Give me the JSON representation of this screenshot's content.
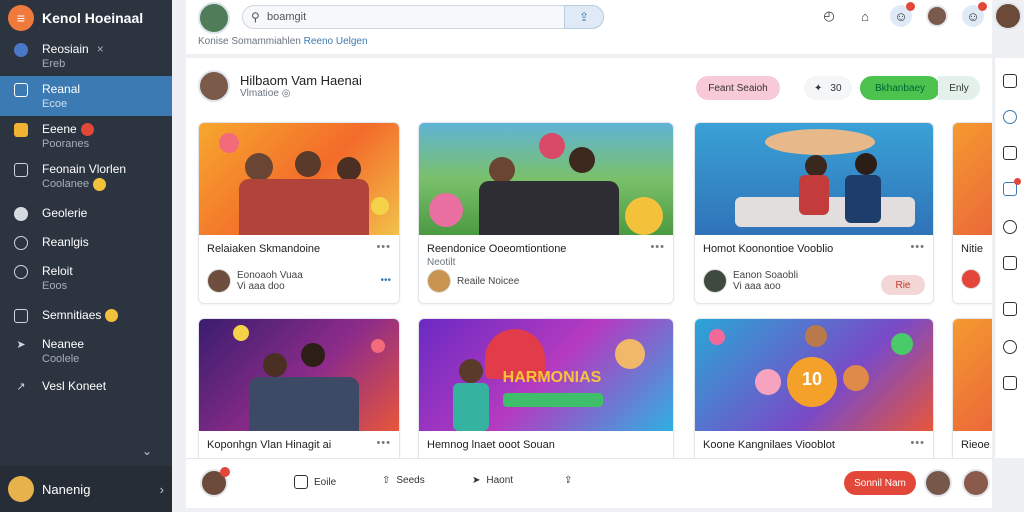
{
  "brand": {
    "name": "Kenol Hoeinaal"
  },
  "sidebar": {
    "items": [
      {
        "label": "Reosiain",
        "sub": "Ereb",
        "extra": "×",
        "active": false,
        "icon": "globe-icon"
      },
      {
        "label": "Reanal",
        "sub": "Ecoe",
        "extra": "",
        "active": true,
        "icon": "feed-icon"
      },
      {
        "label": "Eeene",
        "sub": "Pooranes",
        "extra": "",
        "active": false,
        "icon": "folder-icon"
      },
      {
        "label": "Feonain Vlorlen",
        "sub": "Coolanee",
        "extra": "",
        "active": false,
        "icon": "video-icon"
      },
      {
        "label": "Geolerie",
        "sub": "",
        "extra": "",
        "active": false,
        "icon": "gallery-icon"
      },
      {
        "label": "Reanlgis",
        "sub": "",
        "extra": "",
        "active": false,
        "icon": "globe2-icon"
      },
      {
        "label": "Reloit",
        "sub": "Eoos",
        "extra": "",
        "active": false,
        "icon": "info-icon"
      },
      {
        "label": "Semnitiaes",
        "sub": "",
        "extra": "",
        "active": false,
        "icon": "mail-icon"
      },
      {
        "label": "Neanee",
        "sub": "Coolele",
        "extra": "",
        "active": false,
        "icon": "pin-icon"
      },
      {
        "label": "Vesl Koneet",
        "sub": "",
        "extra": "",
        "active": false,
        "icon": "share-icon"
      }
    ],
    "footer_label": "Nanenig"
  },
  "topbar": {
    "search_value": "boamgit",
    "breadcrumb_text": "Konise Somammiahlen",
    "breadcrumb_link": "Reeno Uelgen"
  },
  "profile": {
    "name": "Hilbaom Vam Haenai",
    "sub": "Vlmatioe"
  },
  "actions": {
    "pink_button": "Feant Seaioh",
    "reaction_count": "30",
    "green_button": "Bkhanbaey",
    "ghost_button": "Enly"
  },
  "cards": [
    {
      "title": "Relaiaken Skmandoine",
      "avatar_line1": "Eonoaoh Vuaa",
      "avatar_line2": "Vi aaa doo",
      "right": "•••",
      "thumb": "warm-guitar"
    },
    {
      "title": "Reendonice Ooeomtiontione",
      "sub": "Neotilt",
      "avatar_line1": "Reaile Noicee",
      "avatar_line2": "",
      "right": "",
      "thumb": "garden-guitar"
    },
    {
      "title": "Homot Koonontioe Vooblio",
      "avatar_line1": "Eanon Soaobli",
      "avatar_line2": "Vi aaa aoo",
      "right": "Rie",
      "thumb": "swing-couple"
    },
    {
      "title": "Nitie",
      "avatar_line1": "",
      "avatar_line2": "",
      "right": "",
      "thumb": "orange"
    },
    {
      "title": "Koponhgn Vlan Hinagit ai",
      "thumb": "concert"
    },
    {
      "title": "Hemnog lnaet ooot Souan",
      "thumb": "harmonias"
    },
    {
      "title": "Koone Kangnilaes Viooblot",
      "thumb": "toys-10"
    },
    {
      "title": "Rieoe",
      "thumb": "orange2"
    }
  ],
  "harmonias_text": "HARMONIAS",
  "toys_number": "10",
  "bottombar": {
    "items": [
      "Eoile",
      "Seeds",
      "Haont"
    ],
    "send_label": "Sonnil Nam"
  },
  "colors": {
    "sidebar_bg": "#2c3440",
    "accent": "#3b7ab2",
    "brand": "#f07a3c",
    "danger": "#e2473a",
    "green": "#4cc24f"
  }
}
